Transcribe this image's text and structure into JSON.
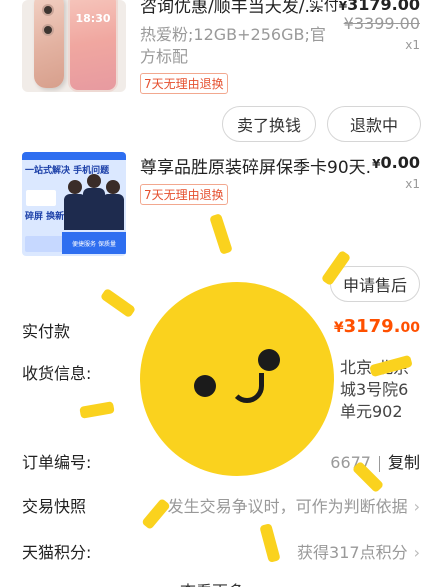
{
  "product1": {
    "title": "咨询优惠/顺丰当天发/...",
    "spec": "热爱粉;12GB+256GB;官方标配",
    "tag": "7天无理由退换",
    "price_label": "实付",
    "price_currency": "¥",
    "price_value": "3179.00",
    "original_price": "¥3399.00",
    "qty": "x1",
    "screen_time": "18:30",
    "buttons": {
      "sell": "卖了换钱",
      "refund": "退款中"
    }
  },
  "product2": {
    "title": "尊享品胜原装碎屏保季卡90天...",
    "tag": "7天无理由退换",
    "price_currency": "¥",
    "price_value": "0.00",
    "qty": "x1",
    "thumb_text": {
      "headline": "一站式解决 手机问题",
      "sub": "碎屏 换新",
      "band": "便捷服务 保质量"
    },
    "buttons": {
      "after_sale": "申请售后"
    }
  },
  "rows": {
    "paid": {
      "label": "实付款",
      "currency": "¥",
      "value": "3179.",
      "cents": "00"
    },
    "shipping": {
      "label": "收货信息:",
      "line1": "北京 北京",
      "line2": "城3号院6",
      "line3": "单元902"
    },
    "order_no": {
      "label": "订单编号:",
      "partial": "6677",
      "copy": "复制"
    },
    "snapshot": {
      "label": "交易快照",
      "value": "发生交易争议时，可作为判断依据"
    },
    "points": {
      "label": "天猫积分:",
      "value": "获得317点积分"
    }
  },
  "bottom_partial": "查看更多",
  "overlay": {
    "sticker": "sun-face",
    "color": "#fad21e"
  },
  "colors": {
    "accent": "#ff5000",
    "tag": "#e5502f"
  },
  "icons": {
    "chevron": "›"
  }
}
